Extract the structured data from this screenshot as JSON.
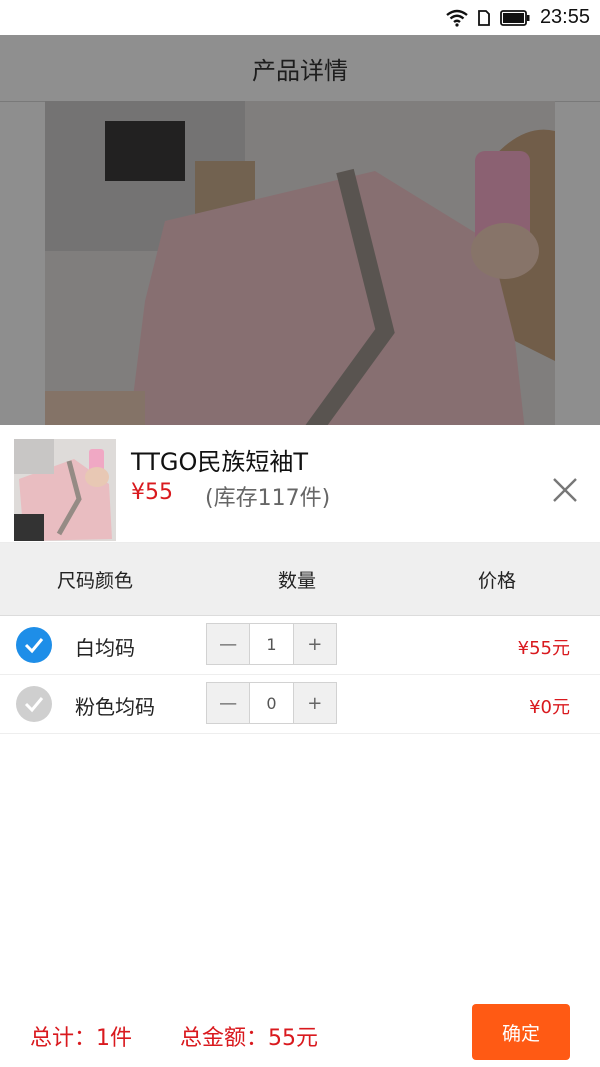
{
  "status_bar": {
    "time": "23:55",
    "icons": [
      "wifi-icon",
      "sim-icon",
      "battery-icon"
    ]
  },
  "page": {
    "title": "产品详情"
  },
  "sheet": {
    "product_name": "TTGO民族短袖T",
    "price": "¥55",
    "stock": "(库存117件)",
    "columns": {
      "size_color": "尺码颜色",
      "quantity": "数量",
      "price": "价格"
    },
    "options": [
      {
        "label": "白均码",
        "checked": true,
        "minus": "—",
        "qty": "1",
        "plus": "+",
        "price": "¥55元"
      },
      {
        "label": "粉色均码",
        "checked": false,
        "minus": "—",
        "qty": "0",
        "plus": "+",
        "price": "¥0元"
      }
    ],
    "footer": {
      "total_count": "总计：1件",
      "total_amount": "总金额：55元",
      "confirm": "确定"
    }
  },
  "colors": {
    "accent_red": "#d9191e",
    "confirm_orange": "#ff5a14",
    "check_blue": "#1e8ee8"
  }
}
